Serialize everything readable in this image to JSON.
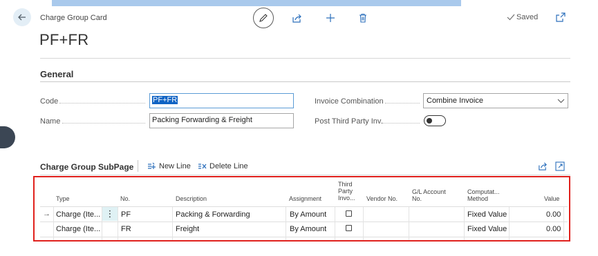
{
  "header": {
    "caption": "Charge Group Card",
    "title": "PF+FR",
    "status": "Saved"
  },
  "general": {
    "section_title": "General",
    "code_label": "Code",
    "code_value": "PF+FR",
    "name_label": "Name",
    "name_value": "Packing Forwarding & Freight",
    "invoice_combination_label": "Invoice Combination",
    "invoice_combination_value": "Combine Invoice",
    "post_third_party_label": "Post Third Party Inv.",
    "post_third_party_enabled": false
  },
  "subpage": {
    "title": "Charge Group SubPage",
    "new_line_label": "New Line",
    "delete_line_label": "Delete Line",
    "columns": {
      "type": "Type",
      "no": "No.",
      "description": "Description",
      "assignment": "Assignment",
      "third_party_1": "Third",
      "third_party_2": "Party",
      "third_party_3": "Invo...",
      "vendor_no": "Vendor No.",
      "gl_account_1": "G/L Account",
      "gl_account_2": "No.",
      "computation_1": "Computat...",
      "computation_2": "Method",
      "value": "Value"
    },
    "rows": [
      {
        "type": "Charge (Ite...",
        "no": "PF",
        "description": "Packing & Forwarding",
        "assignment": "By Amount",
        "third_party": false,
        "vendor_no": "",
        "gl_account": "",
        "computation": "Fixed Value",
        "value": "0.00"
      },
      {
        "type": "Charge (Ite...",
        "no": "FR",
        "description": "Freight",
        "assignment": "By Amount",
        "third_party": false,
        "vendor_no": "",
        "gl_account": "",
        "computation": "Fixed Value",
        "value": "0.00"
      }
    ]
  },
  "colors": {
    "accent": "#0e63c4",
    "highlight_frame": "#e0201c",
    "top_bar": "#a9c9ec"
  },
  "icons": [
    "back-arrow-icon",
    "pencil-icon",
    "share-icon",
    "plus-icon",
    "trash-icon",
    "checkmark-icon",
    "popout-icon",
    "new-line-icon",
    "delete-line-icon",
    "expand-icon",
    "chevron-down-icon",
    "row-arrow-icon",
    "row-menu-icon"
  ]
}
